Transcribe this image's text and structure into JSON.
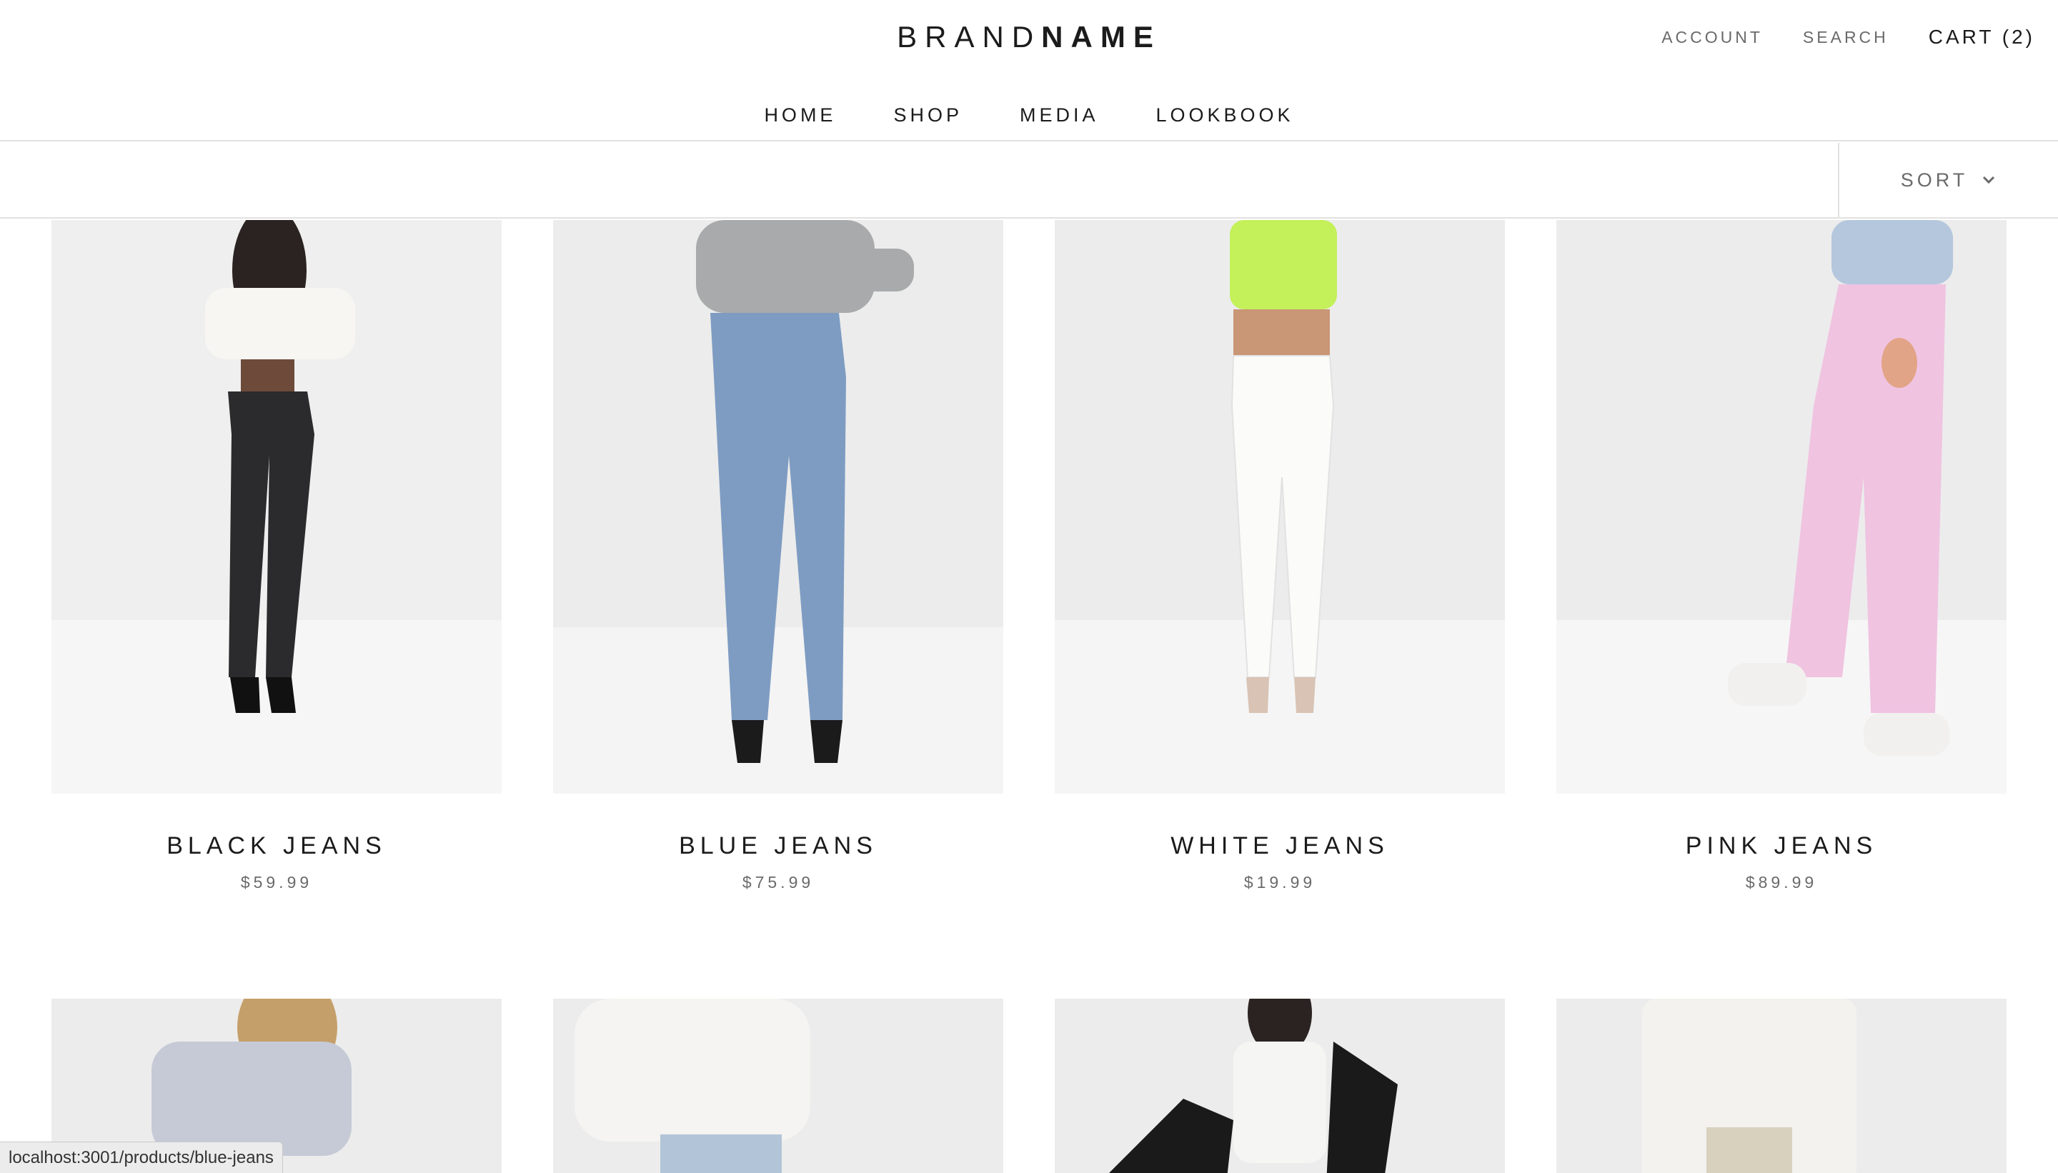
{
  "header": {
    "logo": {
      "light": "BRAND",
      "bold": "NAME"
    },
    "secondary_nav": {
      "account": "ACCOUNT",
      "search": "SEARCH",
      "cart": "CART (2)"
    },
    "main_nav": [
      "HOME",
      "SHOP",
      "MEDIA",
      "LOOKBOOK"
    ]
  },
  "toolbar": {
    "sort_label": "SORT"
  },
  "products": [
    {
      "title": "BLACK JEANS",
      "price": "$59.99",
      "jeans_color": "#2b2a2c",
      "top_color": "#f7f6f3"
    },
    {
      "title": "BLUE JEANS",
      "price": "$75.99",
      "jeans_color": "#7e9cc2",
      "top_color": "#a9aaab"
    },
    {
      "title": "WHITE JEANS",
      "price": "$19.99",
      "jeans_color": "#fbfbfa",
      "top_color": "#c4f05a"
    },
    {
      "title": "PINK JEANS",
      "price": "$89.99",
      "jeans_color": "#f0c3e1",
      "top_color": "#b4c7dd"
    }
  ],
  "products_row2": [
    {
      "top_color": "#c5cad6"
    },
    {
      "top_color": "#f5f4f2"
    },
    {
      "top_color": "#1a1a1a"
    },
    {
      "top_color": "#f3f2ef"
    }
  ],
  "status_bar": {
    "url": "localhost:3001/products/blue-jeans"
  }
}
